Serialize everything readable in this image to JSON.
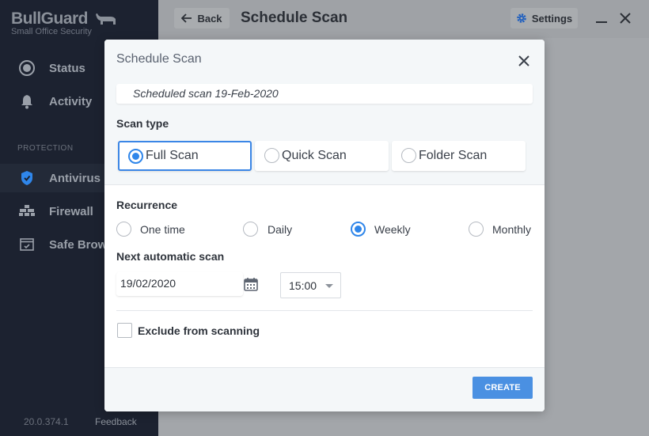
{
  "app": {
    "brand": "BullGuard",
    "subtitle": "Small Office Security"
  },
  "sidebar": {
    "items": [
      {
        "label": "Status",
        "icon": "status-ring-icon"
      },
      {
        "label": "Activity",
        "icon": "bell-icon"
      }
    ],
    "section_label": "PROTECTION",
    "protection_items": [
      {
        "label": "Antivirus",
        "icon": "shield-check-icon",
        "active": true
      },
      {
        "label": "Firewall",
        "icon": "brick-wall-icon"
      },
      {
        "label": "Safe Brows",
        "icon": "browser-check-icon"
      }
    ],
    "version": "20.0.374.1",
    "feedback": "Feedback"
  },
  "header": {
    "back_label": "Back",
    "title": "Schedule Scan",
    "settings_label": "Settings"
  },
  "modal": {
    "title": "Schedule Scan",
    "scheduled_info": "Scheduled scan 19-Feb-2020",
    "scan_type_label": "Scan type",
    "scan_types": [
      {
        "label": "Full Scan",
        "selected": true
      },
      {
        "label": "Quick Scan",
        "selected": false
      },
      {
        "label": "Folder Scan",
        "selected": false
      }
    ],
    "recurrence_label": "Recurrence",
    "recurrence_options": [
      {
        "label": "One time",
        "selected": false
      },
      {
        "label": "Daily",
        "selected": false
      },
      {
        "label": "Weekly",
        "selected": true
      },
      {
        "label": "Monthly",
        "selected": false
      }
    ],
    "next_scan_label": "Next automatic scan",
    "date_value": "19/02/2020",
    "time_value": "15:00",
    "exclude_label": "Exclude from scanning",
    "exclude_checked": false,
    "create_label": "CREATE"
  },
  "colors": {
    "accent": "#2f86ea",
    "sidebar_bg": "#1c2230",
    "create_button": "#4a90e2"
  }
}
